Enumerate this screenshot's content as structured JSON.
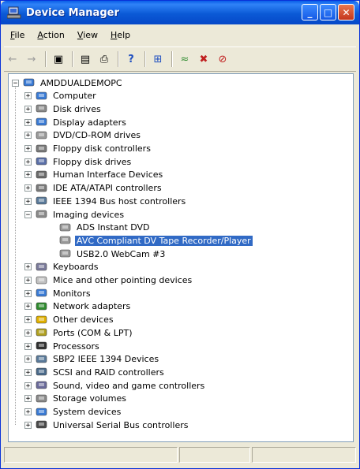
{
  "window": {
    "title": "Device Manager",
    "minimize": "_",
    "maximize": "□",
    "close": "✕"
  },
  "menu": [
    {
      "key": "F",
      "rest": "ile"
    },
    {
      "key": "A",
      "rest": "ction"
    },
    {
      "key": "V",
      "rest": "iew"
    },
    {
      "key": "H",
      "rest": "elp"
    }
  ],
  "toolbar": {
    "back": "←",
    "forward": "→",
    "show_hide": "▣",
    "properties": "▤",
    "print": "⎙",
    "help": "?",
    "scan": "⊞",
    "update": "≈",
    "uninstall": "✖",
    "disable": "⊘"
  },
  "tree": {
    "root": "AMDDUALDEMOPC",
    "categories": [
      {
        "label": "Computer",
        "icon": "computer-icon",
        "color": "#3a7bd5"
      },
      {
        "label": "Disk drives",
        "icon": "disk-drive-icon",
        "color": "#8a8a8a"
      },
      {
        "label": "Display adapters",
        "icon": "display-adapter-icon",
        "color": "#3a7bd5"
      },
      {
        "label": "DVD/CD-ROM drives",
        "icon": "dvd-drive-icon",
        "color": "#9a9a9a"
      },
      {
        "label": "Floppy disk controllers",
        "icon": "floppy-controller-icon",
        "color": "#7a7a7a"
      },
      {
        "label": "Floppy disk drives",
        "icon": "floppy-drive-icon",
        "color": "#5a6fa8"
      },
      {
        "label": "Human Interface Devices",
        "icon": "hid-icon",
        "color": "#6b6b6b"
      },
      {
        "label": "IDE ATA/ATAPI controllers",
        "icon": "ide-controller-icon",
        "color": "#7a7a7a"
      },
      {
        "label": "IEEE 1394 Bus host controllers",
        "icon": "ieee1394-icon",
        "color": "#5a7a9a"
      },
      {
        "label": "Imaging devices",
        "icon": "imaging-device-icon",
        "color": "#8a8a8a",
        "expanded": true,
        "children": [
          {
            "label": "ADS Instant DVD",
            "icon": "camera-icon"
          },
          {
            "label": "AVC Compliant DV Tape Recorder/Player",
            "icon": "camera-icon",
            "selected": true
          },
          {
            "label": "USB2.0 WebCam #3",
            "icon": "camera-icon"
          }
        ]
      },
      {
        "label": "Keyboards",
        "icon": "keyboard-icon",
        "color": "#7a7a9a"
      },
      {
        "label": "Mice and other pointing devices",
        "icon": "mouse-icon",
        "color": "#c0c0c0"
      },
      {
        "label": "Monitors",
        "icon": "monitor-icon",
        "color": "#3a7bd5"
      },
      {
        "label": "Network adapters",
        "icon": "network-adapter-icon",
        "color": "#2e8b2e"
      },
      {
        "label": "Other devices",
        "icon": "other-devices-icon",
        "color": "#e0b000"
      },
      {
        "label": "Ports (COM & LPT)",
        "icon": "port-icon",
        "color": "#b0a020"
      },
      {
        "label": "Processors",
        "icon": "processor-icon",
        "color": "#303030"
      },
      {
        "label": "SBP2 IEEE 1394 Devices",
        "icon": "sbp2-icon",
        "color": "#5a7a9a"
      },
      {
        "label": "SCSI and RAID controllers",
        "icon": "scsi-icon",
        "color": "#4a6a8a"
      },
      {
        "label": "Sound, video and game controllers",
        "icon": "sound-icon",
        "color": "#6a6a9a"
      },
      {
        "label": "Storage volumes",
        "icon": "storage-volume-icon",
        "color": "#8a8a8a"
      },
      {
        "label": "System devices",
        "icon": "system-device-icon",
        "color": "#3a7bd5"
      },
      {
        "label": "Universal Serial Bus controllers",
        "icon": "usb-icon",
        "color": "#4a4a4a"
      }
    ]
  }
}
